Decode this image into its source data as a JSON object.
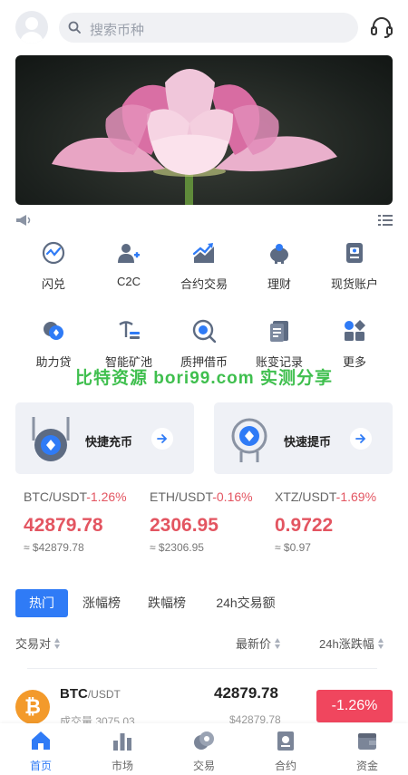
{
  "header": {
    "avatar_icon": "user-avatar-icon",
    "search_placeholder": "搜索币种",
    "search_icon": "search-icon",
    "support_icon": "headset-icon"
  },
  "banner": {
    "image": "pink-lotus-photo"
  },
  "notice": {
    "speaker_icon": "megaphone-icon",
    "list_icon": "list-icon"
  },
  "quick_menu": [
    {
      "label": "闪兑",
      "icon": "swap-gauge-icon"
    },
    {
      "label": "C2C",
      "icon": "user-plus-icon"
    },
    {
      "label": "合约交易",
      "icon": "trend-chart-icon"
    },
    {
      "label": "理财",
      "icon": "piggy-bank-icon"
    },
    {
      "label": "现货账户",
      "icon": "wallet-card-icon"
    },
    {
      "label": "助力贷",
      "icon": "loan-coin-icon"
    },
    {
      "label": "智能矿池",
      "icon": "pickaxe-icon"
    },
    {
      "label": "质押借币",
      "icon": "target-coin-icon"
    },
    {
      "label": "账变记录",
      "icon": "ledger-icon"
    },
    {
      "label": "更多",
      "icon": "more-grid-icon"
    }
  ],
  "watermark": "比特资源 bori99.com 实测分享",
  "cards": {
    "deposit": {
      "label": "快捷充币",
      "icon": "deposit-coin-icon"
    },
    "withdraw": {
      "label": "快速提币",
      "icon": "withdraw-coin-icon"
    }
  },
  "tickers": [
    {
      "pair": "BTC/USDT",
      "change": "-1.26%",
      "price": "42879.78",
      "usd": "≈ $42879.78"
    },
    {
      "pair": "ETH/USDT",
      "change": "-0.16%",
      "price": "2306.95",
      "usd": "≈ $2306.95"
    },
    {
      "pair": "XTZ/USDT",
      "change": "-1.69%",
      "price": "0.9722",
      "usd": "≈ $0.97"
    }
  ],
  "tabs": [
    "热门",
    "涨幅榜",
    "跌幅榜",
    "24h交易额"
  ],
  "columns": {
    "pair": "交易对",
    "last": "最新价",
    "change": "24h涨跌幅"
  },
  "market_rows": [
    {
      "coin_symbol": "₿",
      "base": "BTC",
      "quote": "/USDT",
      "volume": "成交量 3075.03",
      "last": "42879.78",
      "last_usd": "$42879.78",
      "change": "-1.26%"
    }
  ],
  "bottom_nav": [
    {
      "label": "首页",
      "icon": "home-icon"
    },
    {
      "label": "市场",
      "icon": "bar-chart-icon"
    },
    {
      "label": "交易",
      "icon": "coins-icon"
    },
    {
      "label": "合约",
      "icon": "contract-icon"
    },
    {
      "label": "资金",
      "icon": "wallet-icon"
    }
  ],
  "colors": {
    "accent": "#2f7bf6",
    "down": "#e35561",
    "badge_down": "#f0465e",
    "watermark": "#3fbf4e"
  }
}
